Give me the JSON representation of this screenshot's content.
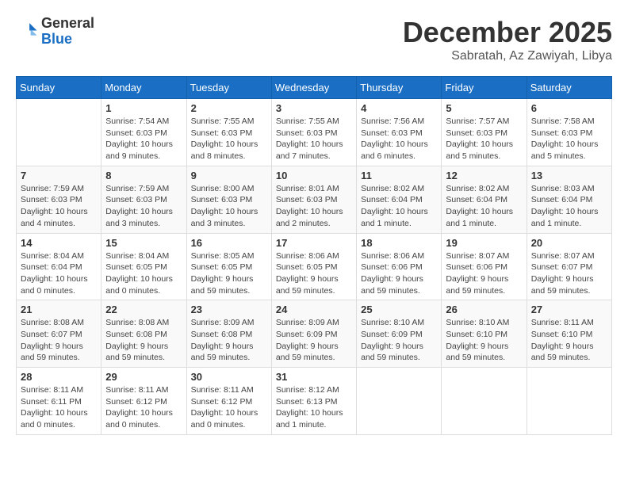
{
  "logo": {
    "line1": "General",
    "line2": "Blue"
  },
  "title": "December 2025",
  "location": "Sabratah, Az Zawiyah, Libya",
  "weekdays": [
    "Sunday",
    "Monday",
    "Tuesday",
    "Wednesday",
    "Thursday",
    "Friday",
    "Saturday"
  ],
  "weeks": [
    [
      {
        "day": "",
        "content": ""
      },
      {
        "day": "1",
        "content": "Sunrise: 7:54 AM\nSunset: 6:03 PM\nDaylight: 10 hours\nand 9 minutes."
      },
      {
        "day": "2",
        "content": "Sunrise: 7:55 AM\nSunset: 6:03 PM\nDaylight: 10 hours\nand 8 minutes."
      },
      {
        "day": "3",
        "content": "Sunrise: 7:55 AM\nSunset: 6:03 PM\nDaylight: 10 hours\nand 7 minutes."
      },
      {
        "day": "4",
        "content": "Sunrise: 7:56 AM\nSunset: 6:03 PM\nDaylight: 10 hours\nand 6 minutes."
      },
      {
        "day": "5",
        "content": "Sunrise: 7:57 AM\nSunset: 6:03 PM\nDaylight: 10 hours\nand 5 minutes."
      },
      {
        "day": "6",
        "content": "Sunrise: 7:58 AM\nSunset: 6:03 PM\nDaylight: 10 hours\nand 5 minutes."
      }
    ],
    [
      {
        "day": "7",
        "content": "Sunrise: 7:59 AM\nSunset: 6:03 PM\nDaylight: 10 hours\nand 4 minutes."
      },
      {
        "day": "8",
        "content": "Sunrise: 7:59 AM\nSunset: 6:03 PM\nDaylight: 10 hours\nand 3 minutes."
      },
      {
        "day": "9",
        "content": "Sunrise: 8:00 AM\nSunset: 6:03 PM\nDaylight: 10 hours\nand 3 minutes."
      },
      {
        "day": "10",
        "content": "Sunrise: 8:01 AM\nSunset: 6:03 PM\nDaylight: 10 hours\nand 2 minutes."
      },
      {
        "day": "11",
        "content": "Sunrise: 8:02 AM\nSunset: 6:04 PM\nDaylight: 10 hours\nand 1 minute."
      },
      {
        "day": "12",
        "content": "Sunrise: 8:02 AM\nSunset: 6:04 PM\nDaylight: 10 hours\nand 1 minute."
      },
      {
        "day": "13",
        "content": "Sunrise: 8:03 AM\nSunset: 6:04 PM\nDaylight: 10 hours\nand 1 minute."
      }
    ],
    [
      {
        "day": "14",
        "content": "Sunrise: 8:04 AM\nSunset: 6:04 PM\nDaylight: 10 hours\nand 0 minutes."
      },
      {
        "day": "15",
        "content": "Sunrise: 8:04 AM\nSunset: 6:05 PM\nDaylight: 10 hours\nand 0 minutes."
      },
      {
        "day": "16",
        "content": "Sunrise: 8:05 AM\nSunset: 6:05 PM\nDaylight: 9 hours\nand 59 minutes."
      },
      {
        "day": "17",
        "content": "Sunrise: 8:06 AM\nSunset: 6:05 PM\nDaylight: 9 hours\nand 59 minutes."
      },
      {
        "day": "18",
        "content": "Sunrise: 8:06 AM\nSunset: 6:06 PM\nDaylight: 9 hours\nand 59 minutes."
      },
      {
        "day": "19",
        "content": "Sunrise: 8:07 AM\nSunset: 6:06 PM\nDaylight: 9 hours\nand 59 minutes."
      },
      {
        "day": "20",
        "content": "Sunrise: 8:07 AM\nSunset: 6:07 PM\nDaylight: 9 hours\nand 59 minutes."
      }
    ],
    [
      {
        "day": "21",
        "content": "Sunrise: 8:08 AM\nSunset: 6:07 PM\nDaylight: 9 hours\nand 59 minutes."
      },
      {
        "day": "22",
        "content": "Sunrise: 8:08 AM\nSunset: 6:08 PM\nDaylight: 9 hours\nand 59 minutes."
      },
      {
        "day": "23",
        "content": "Sunrise: 8:09 AM\nSunset: 6:08 PM\nDaylight: 9 hours\nand 59 minutes."
      },
      {
        "day": "24",
        "content": "Sunrise: 8:09 AM\nSunset: 6:09 PM\nDaylight: 9 hours\nand 59 minutes."
      },
      {
        "day": "25",
        "content": "Sunrise: 8:10 AM\nSunset: 6:09 PM\nDaylight: 9 hours\nand 59 minutes."
      },
      {
        "day": "26",
        "content": "Sunrise: 8:10 AM\nSunset: 6:10 PM\nDaylight: 9 hours\nand 59 minutes."
      },
      {
        "day": "27",
        "content": "Sunrise: 8:11 AM\nSunset: 6:10 PM\nDaylight: 9 hours\nand 59 minutes."
      }
    ],
    [
      {
        "day": "28",
        "content": "Sunrise: 8:11 AM\nSunset: 6:11 PM\nDaylight: 10 hours\nand 0 minutes."
      },
      {
        "day": "29",
        "content": "Sunrise: 8:11 AM\nSunset: 6:12 PM\nDaylight: 10 hours\nand 0 minutes."
      },
      {
        "day": "30",
        "content": "Sunrise: 8:11 AM\nSunset: 6:12 PM\nDaylight: 10 hours\nand 0 minutes."
      },
      {
        "day": "31",
        "content": "Sunrise: 8:12 AM\nSunset: 6:13 PM\nDaylight: 10 hours\nand 1 minute."
      },
      {
        "day": "",
        "content": ""
      },
      {
        "day": "",
        "content": ""
      },
      {
        "day": "",
        "content": ""
      }
    ]
  ]
}
